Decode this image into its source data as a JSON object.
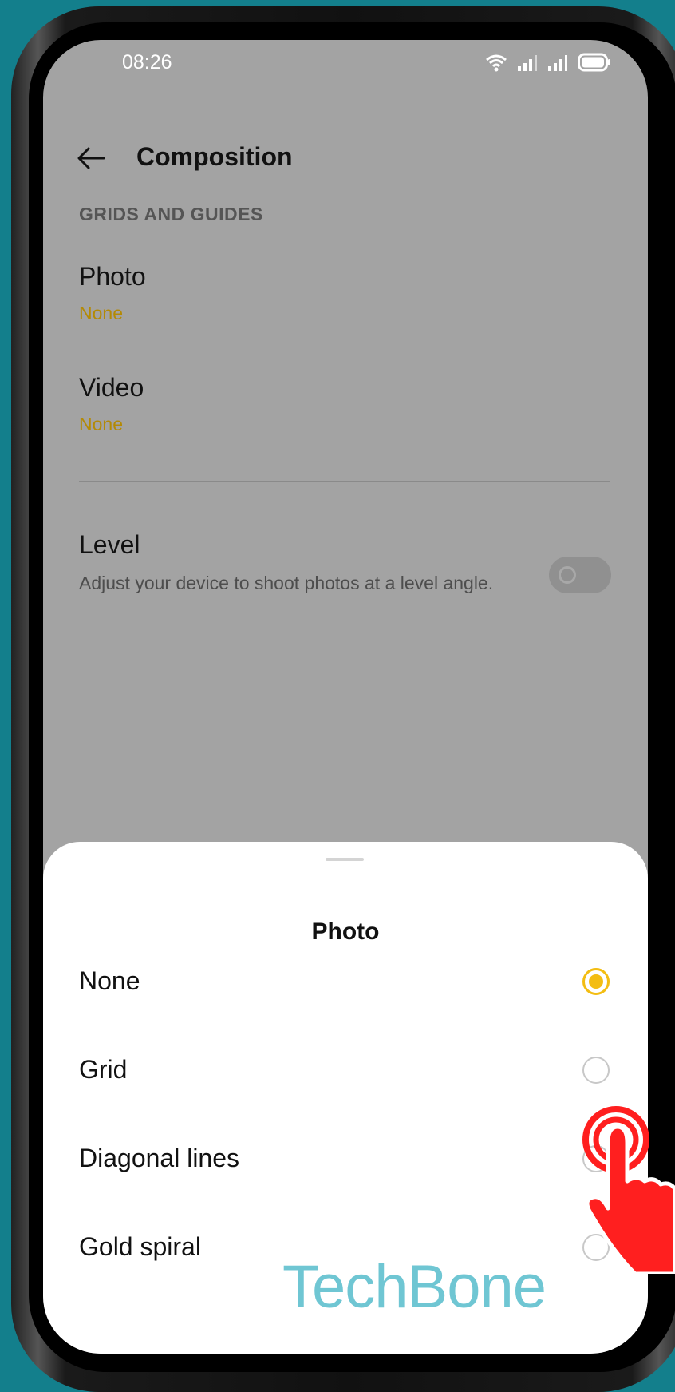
{
  "status_bar": {
    "time": "08:26",
    "icons": [
      "wifi-icon",
      "signal-icon",
      "signal-icon",
      "battery-icon"
    ]
  },
  "app_bar": {
    "title": "Composition",
    "back_icon": "arrow-left-icon"
  },
  "settings": {
    "section_header": "GRIDS AND GUIDES",
    "photo": {
      "title": "Photo",
      "value": "None"
    },
    "video": {
      "title": "Video",
      "value": "None"
    },
    "level": {
      "title": "Level",
      "summary": "Adjust your device to shoot photos at a level angle.",
      "enabled": false
    }
  },
  "sheet": {
    "title": "Photo",
    "options": [
      {
        "label": "None",
        "selected": true
      },
      {
        "label": "Grid",
        "selected": false
      },
      {
        "label": "Diagonal lines",
        "selected": false
      },
      {
        "label": "Gold spiral",
        "selected": false
      }
    ]
  },
  "watermark": "TechBone",
  "colors": {
    "accent": "#f3bd12",
    "value_text": "#b48a05",
    "background": "#137f8c",
    "tap_indicator": "#ff1f1f"
  }
}
